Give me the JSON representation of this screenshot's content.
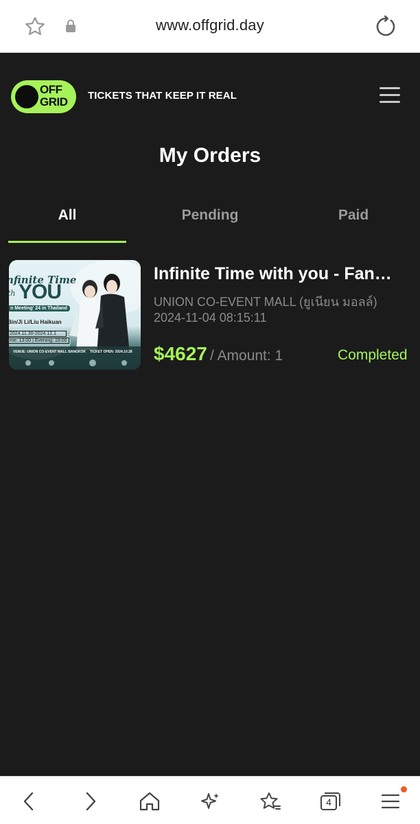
{
  "browser": {
    "url": "www.offgrid.day",
    "tab_count": "4"
  },
  "header": {
    "logo_text_line1": "OFF",
    "logo_text_line2": "GRID",
    "tagline": "TICKETS THAT KEEP IT REAL"
  },
  "page": {
    "title": "My Orders"
  },
  "tabs": [
    {
      "label": "All",
      "active": true
    },
    {
      "label": "Pending",
      "active": false
    },
    {
      "label": "Paid",
      "active": false
    }
  ],
  "orders": [
    {
      "title": "Infinite Time with you - Fan…",
      "venue": "UNION CO-EVENT MALL (ยูเนียน มอลล์)",
      "datetime": "2024-11-04 08:15:11",
      "price": "$4627",
      "amount": "/ Amount: 1",
      "status": "Completed",
      "poster": {
        "title_line1": "nfinite Time",
        "title_line2": "YOU",
        "title_small": "th",
        "subtitle": "n Meeting' 24 in Thailand",
        "cast": "Bin/Ji  Li/Liu Haikuan",
        "dates": "2024.11.30-2024.12.1",
        "times": "me: 13:00 | Evening: 19:00",
        "venue": "VENUE: UNION CO-EVENT MALL BANGKOK",
        "ticket_open": "TICKET OPEN: 2024.10.28"
      }
    }
  ],
  "colors": {
    "accent": "#a6f25a",
    "background": "#1b1b1b",
    "muted": "#8a8a8a"
  }
}
